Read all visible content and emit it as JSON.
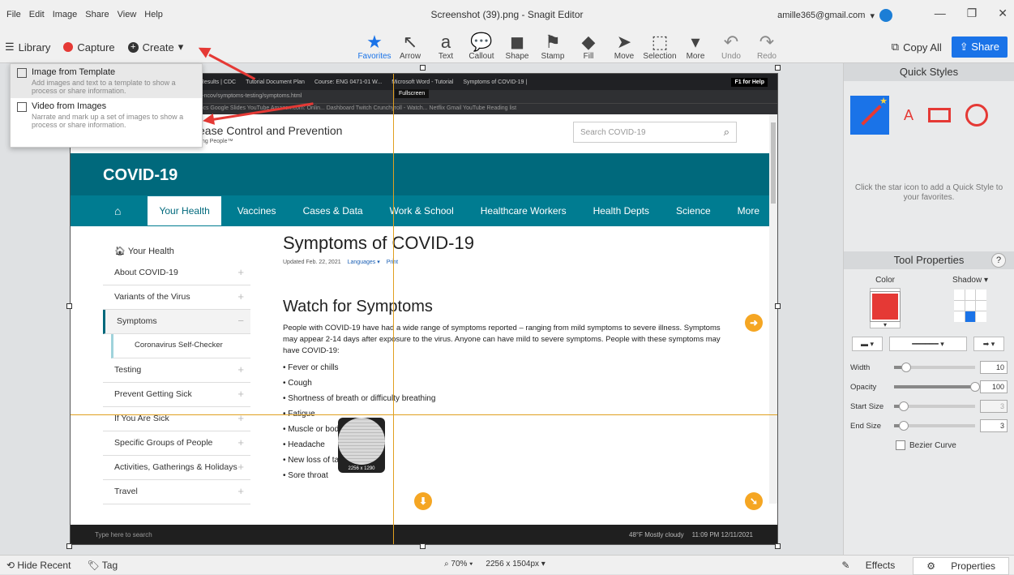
{
  "window": {
    "title": "Screenshot (39).png - Snagit Editor",
    "menu": [
      "File",
      "Edit",
      "Image",
      "Share",
      "View",
      "Help"
    ],
    "user": "amille365@gmail.com",
    "controls": [
      "—",
      "❐",
      "✕"
    ]
  },
  "toolbar": {
    "library": "Library",
    "capture": "Capture",
    "create": "Create",
    "tools": [
      {
        "label": "Favorites",
        "icon": "★",
        "name": "favorites"
      },
      {
        "label": "Arrow",
        "icon": "↖",
        "name": "arrow"
      },
      {
        "label": "Text",
        "icon": "a",
        "name": "text"
      },
      {
        "label": "Callout",
        "icon": "💬",
        "name": "callout"
      },
      {
        "label": "Shape",
        "icon": "◼",
        "name": "shape"
      },
      {
        "label": "Stamp",
        "icon": "⚑",
        "name": "stamp"
      },
      {
        "label": "Fill",
        "icon": "◆",
        "name": "fill"
      },
      {
        "label": "Move",
        "icon": "➤",
        "name": "move"
      },
      {
        "label": "Selection",
        "icon": "⬚",
        "name": "selection"
      },
      {
        "label": "More",
        "icon": "▾",
        "name": "more"
      },
      {
        "label": "Undo",
        "icon": "↶",
        "name": "undo"
      },
      {
        "label": "Redo",
        "icon": "↷",
        "name": "redo"
      }
    ],
    "copy_all": "Copy All",
    "share": "Share"
  },
  "create_menu": [
    {
      "title": "Image from Template",
      "desc": "Add images and text to a template to show a process or share information."
    },
    {
      "title": "Video from Images",
      "desc": "Narrate and mark up a set of images to show a process or share information."
    }
  ],
  "screenshot": {
    "browser_tabs": [
      "h Results | CDC",
      "Tutorial Document Plan",
      "Course: ENG 0471-01 W...",
      "Microsoft Word - Tutorial",
      "Symptoms of COVID-19 |"
    ],
    "url": "virus/2019-ncov/symptoms-testing/symptoms.html",
    "bookmarks": "Google Docs   Google Slides   YouTube   Amazon.com: Onlin...   Dashboard   Twitch   Crunchyroll - Watch...   Netflix   Gmail   YouTube   Reading list",
    "f1_help": "F1 for Help",
    "fullscreen": "Fullscreen",
    "cdc_title": "ease Control and Prevention",
    "cdc_tagline": "CDC 24/7: Saving Lives, Protecting People™",
    "search_placeholder": "Search COVID-19",
    "banner": "COVID-19",
    "nav": [
      "Your Health",
      "Vaccines",
      "Cases & Data",
      "Work & School",
      "Healthcare Workers",
      "Health Depts",
      "Science",
      "More"
    ],
    "sidebar_header": "Your Health",
    "sidebar": [
      "About COVID-19",
      "Variants of the Virus",
      "Symptoms",
      "Coronavirus Self-Checker",
      "Testing",
      "Prevent Getting Sick",
      "If You Are Sick",
      "Specific Groups of People",
      "Activities, Gatherings & Holidays",
      "Travel"
    ],
    "heading": "Symptoms of COVID-19",
    "updated": "Updated Feb. 22, 2021",
    "languages": "Languages ▾",
    "print": "Print",
    "subheading": "Watch for Symptoms",
    "paragraph": "People with COVID-19 have had a wide range of symptoms reported – ranging from mild symptoms to severe illness. Symptoms may appear 2-14 days after exposure to the virus. Anyone can have mild to severe symptoms. People with these symptoms may have COVID-19:",
    "symptoms": [
      "Fever or chills",
      "Cough",
      "Shortness of breath or difficulty breathing",
      "Fatigue",
      "Muscle or body aches",
      "Headache",
      "New loss of taste or smell",
      "Sore throat"
    ],
    "magnifier_size": "2256 x 1290",
    "taskbar_search": "Type here to search",
    "weather": "48°F  Mostly cloudy",
    "clock": "11:09 PM  12/11/2021"
  },
  "right_panel": {
    "quick_styles": "Quick Styles",
    "hint": "Click the star icon to add a Quick Style to your favorites.",
    "tool_properties": "Tool Properties",
    "color_label": "Color",
    "shadow_label": "Shadow ▾",
    "accent": "#e53935",
    "sliders": [
      {
        "label": "Width",
        "value": "10",
        "level": 0.15,
        "disabled": false
      },
      {
        "label": "Opacity",
        "value": "100",
        "level": 1.0,
        "disabled": false
      },
      {
        "label": "Start Size",
        "value": "3",
        "level": 0.12,
        "disabled": true
      },
      {
        "label": "End Size",
        "value": "3",
        "level": 0.12,
        "disabled": false
      }
    ],
    "bezier": "Bezier Curve"
  },
  "status_bar": {
    "hide_recent": "Hide Recent",
    "tag": "Tag",
    "zoom": "70% ▾",
    "size": "2256 x 1504px ▾",
    "effects": "Effects",
    "properties": "Properties"
  }
}
